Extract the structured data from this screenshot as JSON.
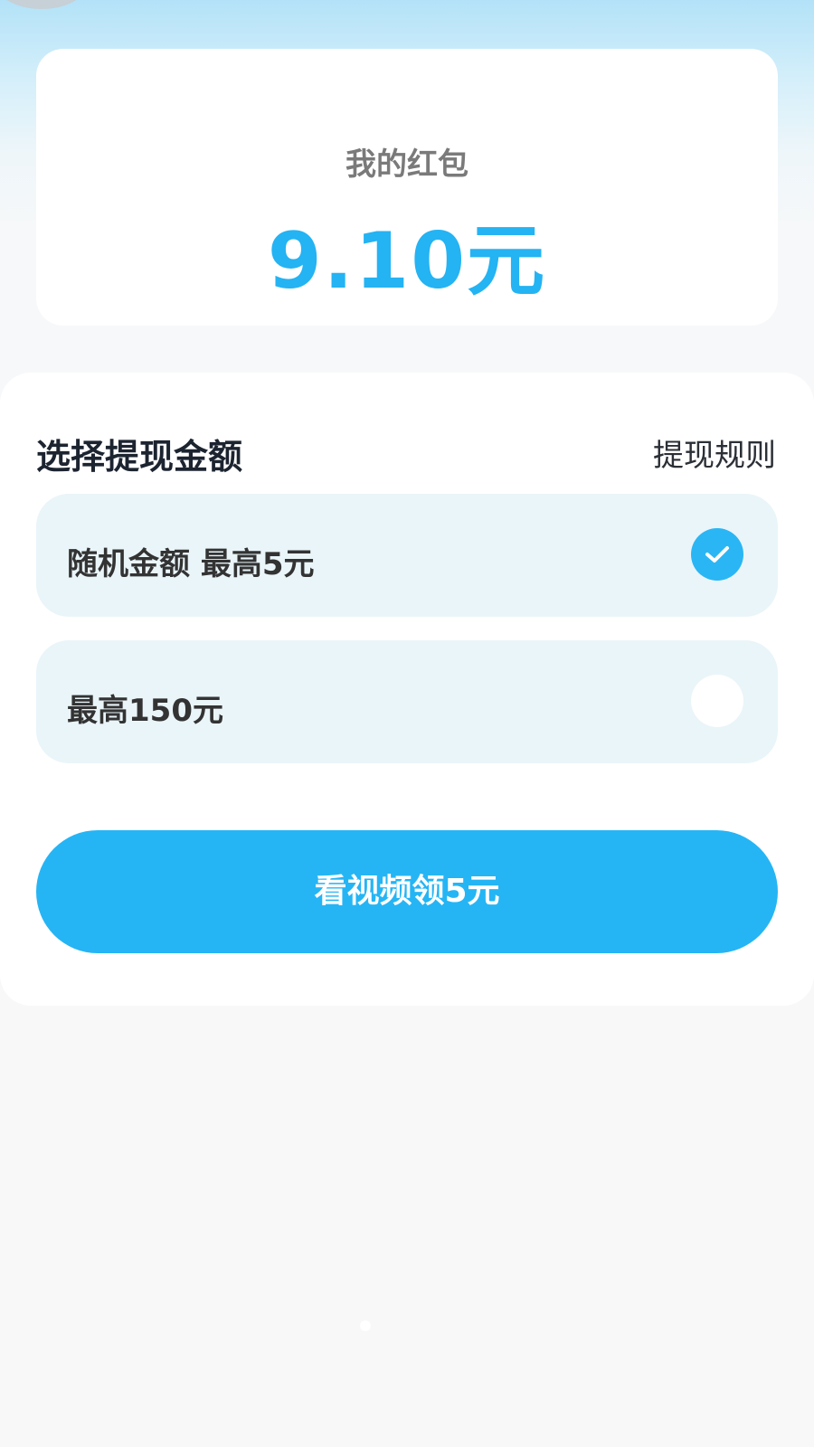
{
  "balance_card": {
    "label": "我的红包",
    "amount": "9.10元"
  },
  "withdraw": {
    "title": "选择提现金额",
    "rules_link": "提现规则",
    "options": [
      {
        "label": "随机金额 最高5元",
        "selected": true
      },
      {
        "label": "最高150元",
        "selected": false
      }
    ]
  },
  "cta": {
    "label": "看视频领5元"
  },
  "icons": {
    "back": "back-button-icon",
    "check": "checkmark-icon"
  },
  "colors": {
    "accent": "#24b3f3",
    "option_bg": "#eaf5f9",
    "button_bg": "#25b5f5"
  }
}
